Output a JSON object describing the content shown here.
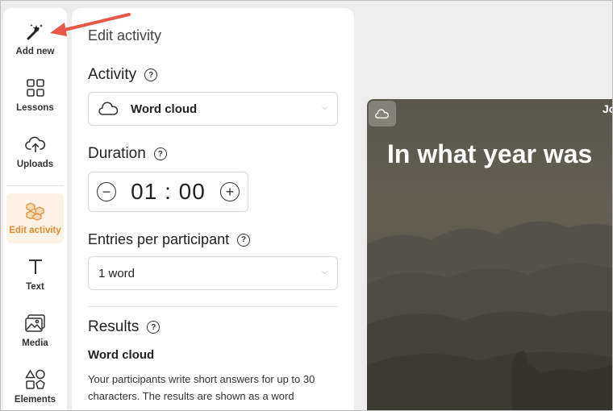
{
  "rail": {
    "items": [
      {
        "label": "Add new",
        "icon": "magic-wand-icon"
      },
      {
        "label": "Lessons",
        "icon": "grid-icon"
      },
      {
        "label": "Uploads",
        "icon": "cloud-upload-icon"
      },
      {
        "label": "Edit activity",
        "icon": "blocks-icon",
        "active": true
      },
      {
        "label": "Text",
        "icon": "text-icon"
      },
      {
        "label": "Media",
        "icon": "image-icon"
      },
      {
        "label": "Elements",
        "icon": "shapes-icon"
      }
    ]
  },
  "panel": {
    "title": "Edit activity",
    "activity": {
      "heading": "Activity",
      "help": "?",
      "value": "Word cloud"
    },
    "duration": {
      "heading": "Duration",
      "help": "?",
      "value": "01 : 00"
    },
    "entries": {
      "heading": "Entries per participant",
      "help": "?",
      "value": "1 word"
    },
    "results": {
      "heading": "Results",
      "help": "?",
      "subheading": "Word cloud",
      "description": "Your participants write short answers for up to 30 characters. The results are shown as a word"
    }
  },
  "slide": {
    "question": "In what year was",
    "corner_text": "Jo"
  },
  "colors": {
    "accent": "#e58a2e",
    "arrow": "#e8584a"
  }
}
